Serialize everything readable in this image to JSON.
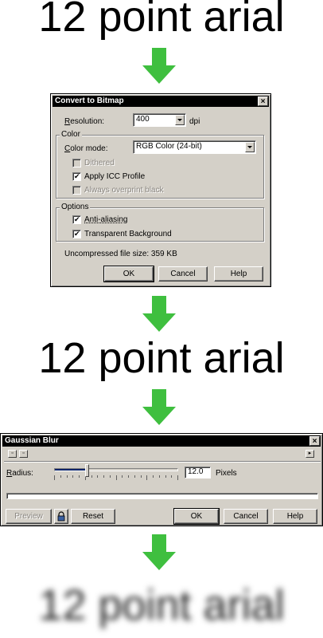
{
  "banners": {
    "top": "12 point arial",
    "middle": "12 point arial",
    "bottom": "12 point arial"
  },
  "arrow_color": "#3fbf3f",
  "convert_dialog": {
    "title": "Convert to Bitmap",
    "resolution_label": "Resolution:",
    "resolution_value": "400",
    "resolution_unit": "dpi",
    "color_group": "Color",
    "color_mode_label": "Color mode:",
    "color_mode_value": "RGB Color (24-bit)",
    "dithered_label": "Dithered",
    "dithered_checked": false,
    "apply_icc_label": "Apply ICC Profile",
    "apply_icc_checked": true,
    "overprint_label": "Always overprint black",
    "overprint_checked": false,
    "options_group": "Options",
    "antialias_label": "Anti-aliasing",
    "antialias_checked": true,
    "transparent_label": "Transparent Background",
    "transparent_checked": true,
    "filesize_text": "Uncompressed file size: 359 KB",
    "ok_label": "OK",
    "cancel_label": "Cancel",
    "help_label": "Help"
  },
  "blur_dialog": {
    "title": "Gaussian Blur",
    "radius_label": "Radius:",
    "radius_value": "12.0",
    "radius_unit": "Pixels",
    "radius_fraction": 0.26,
    "preview_label": "Preview",
    "reset_label": "Reset",
    "ok_label": "OK",
    "cancel_label": "Cancel",
    "help_label": "Help"
  }
}
